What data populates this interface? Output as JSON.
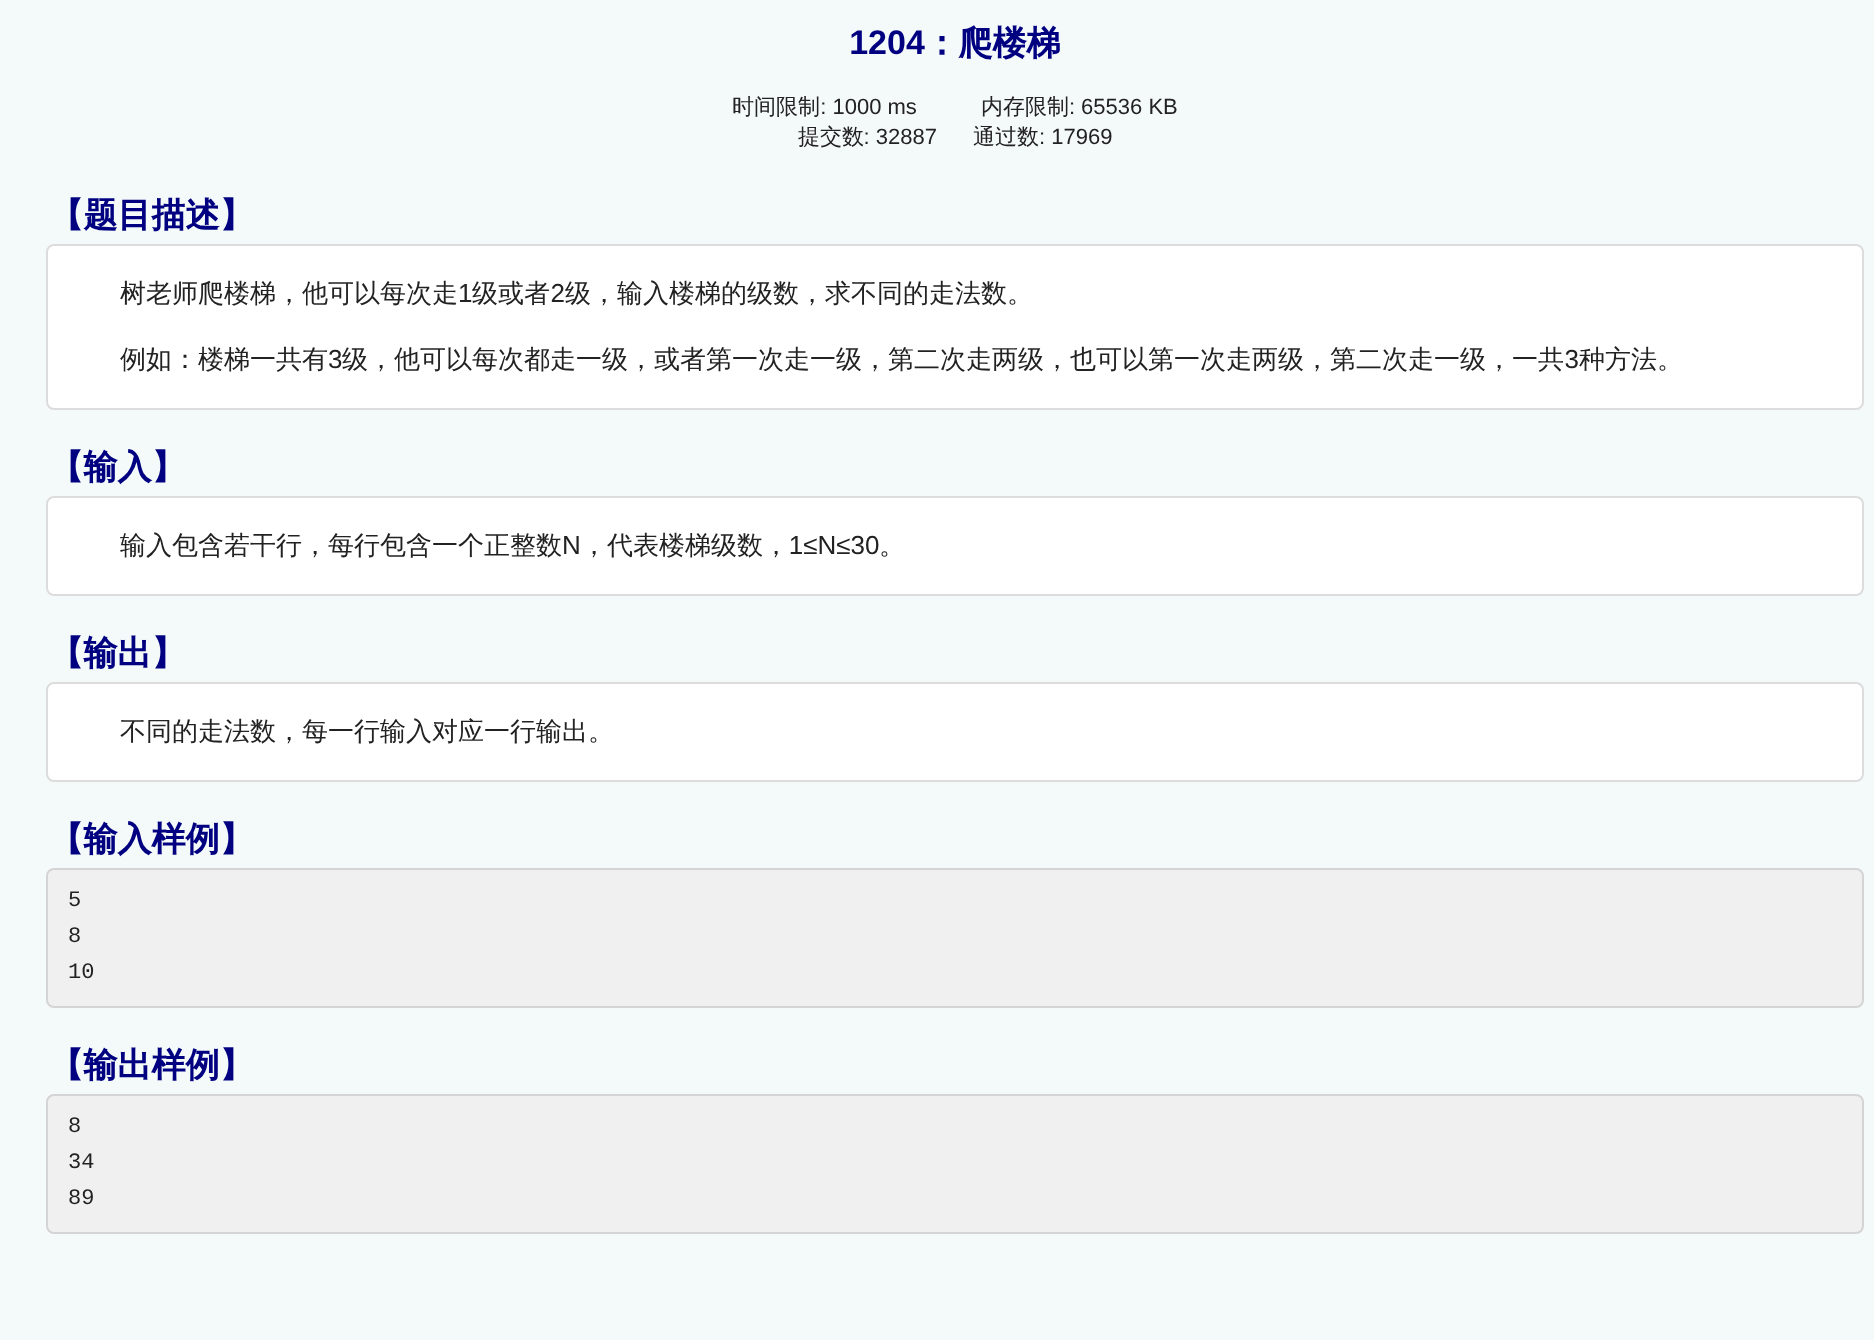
{
  "title": "1204：爬楼梯",
  "limits": [
    "时间限制: 1000 ms",
    "内存限制: 65536 KB"
  ],
  "counts": [
    "提交数: 32887",
    "通过数: 17969"
  ],
  "sections": [
    {
      "heading": "【题目描述】",
      "kind": "text",
      "lines": [
        "树老师爬楼梯，他可以每次走1级或者2级，输入楼梯的级数，求不同的走法数。",
        "例如：楼梯一共有3级，他可以每次都走一级，或者第一次走一级，第二次走两级，也可以第一次走两级，第二次走一级，一共3种方法。"
      ]
    },
    {
      "heading": "【输入】",
      "kind": "text",
      "lines": [
        "输入包含若干行，每行包含一个正整数N，代表楼梯级数，1≤N≤30。"
      ]
    },
    {
      "heading": "【输出】",
      "kind": "text",
      "lines": [
        "不同的走法数，每一行输入对应一行输出。"
      ]
    },
    {
      "heading": "【输入样例】",
      "kind": "sample",
      "lines": [
        "5",
        "8",
        "10"
      ]
    },
    {
      "heading": "【输出样例】",
      "kind": "sample",
      "lines": [
        "8",
        "34",
        "89"
      ]
    }
  ]
}
